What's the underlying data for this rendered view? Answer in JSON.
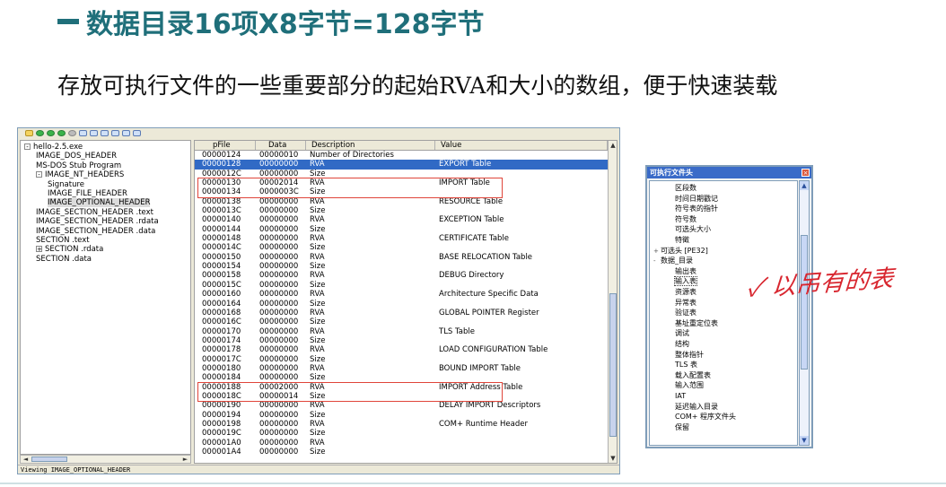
{
  "slide": {
    "title": "数据目录16项X8字节=128字节",
    "subtitle": "存放可执行文件的一些重要部分的起始RVA和大小的数组，便于快速装载"
  },
  "viewer": {
    "status_text": "Viewing IMAGE_OPTIONAL_HEADER",
    "tree": [
      {
        "label": "hello-2.5.exe",
        "level": 0,
        "expander": "-"
      },
      {
        "label": "IMAGE_DOS_HEADER",
        "level": 1,
        "expander": ""
      },
      {
        "label": "MS-DOS Stub Program",
        "level": 1,
        "expander": ""
      },
      {
        "label": "IMAGE_NT_HEADERS",
        "level": 1,
        "expander": "-"
      },
      {
        "label": "Signature",
        "level": 2,
        "expander": ""
      },
      {
        "label": "IMAGE_FILE_HEADER",
        "level": 2,
        "expander": ""
      },
      {
        "label": "IMAGE_OPTIONAL_HEADER",
        "level": 2,
        "expander": "",
        "selected": true
      },
      {
        "label": "IMAGE_SECTION_HEADER .text",
        "level": 1,
        "expander": ""
      },
      {
        "label": "IMAGE_SECTION_HEADER .rdata",
        "level": 1,
        "expander": ""
      },
      {
        "label": "IMAGE_SECTION_HEADER .data",
        "level": 1,
        "expander": ""
      },
      {
        "label": "SECTION .text",
        "level": 1,
        "expander": ""
      },
      {
        "label": "SECTION .rdata",
        "level": 1,
        "expander": "+"
      },
      {
        "label": "SECTION .data",
        "level": 1,
        "expander": ""
      }
    ],
    "columns": [
      "pFile",
      "Data",
      "Description",
      "Value"
    ],
    "rows": [
      [
        "00000124",
        "00000010",
        "Number of Directories",
        ""
      ],
      [
        "00000128",
        "00000000",
        "RVA",
        "EXPORT Table"
      ],
      [
        "0000012C",
        "00000000",
        "Size",
        ""
      ],
      [
        "00000130",
        "00002014",
        "RVA",
        "IMPORT Table"
      ],
      [
        "00000134",
        "0000003C",
        "Size",
        ""
      ],
      [
        "00000138",
        "00000000",
        "RVA",
        "RESOURCE Table"
      ],
      [
        "0000013C",
        "00000000",
        "Size",
        ""
      ],
      [
        "00000140",
        "00000000",
        "RVA",
        "EXCEPTION Table"
      ],
      [
        "00000144",
        "00000000",
        "Size",
        ""
      ],
      [
        "00000148",
        "00000000",
        "RVA",
        "CERTIFICATE Table"
      ],
      [
        "0000014C",
        "00000000",
        "Size",
        ""
      ],
      [
        "00000150",
        "00000000",
        "RVA",
        "BASE RELOCATION Table"
      ],
      [
        "00000154",
        "00000000",
        "Size",
        ""
      ],
      [
        "00000158",
        "00000000",
        "RVA",
        "DEBUG Directory"
      ],
      [
        "0000015C",
        "00000000",
        "Size",
        ""
      ],
      [
        "00000160",
        "00000000",
        "RVA",
        "Architecture Specific Data"
      ],
      [
        "00000164",
        "00000000",
        "Size",
        ""
      ],
      [
        "00000168",
        "00000000",
        "RVA",
        "GLOBAL POINTER Register"
      ],
      [
        "0000016C",
        "00000000",
        "Size",
        ""
      ],
      [
        "00000170",
        "00000000",
        "RVA",
        "TLS Table"
      ],
      [
        "00000174",
        "00000000",
        "Size",
        ""
      ],
      [
        "00000178",
        "00000000",
        "RVA",
        "LOAD CONFIGURATION Table"
      ],
      [
        "0000017C",
        "00000000",
        "Size",
        ""
      ],
      [
        "00000180",
        "00000000",
        "RVA",
        "BOUND IMPORT Table"
      ],
      [
        "00000184",
        "00000000",
        "Size",
        ""
      ],
      [
        "00000188",
        "00002000",
        "RVA",
        "IMPORT Address Table"
      ],
      [
        "0000018C",
        "00000014",
        "Size",
        ""
      ],
      [
        "00000190",
        "00000000",
        "RVA",
        "DELAY IMPORT Descriptors"
      ],
      [
        "00000194",
        "00000000",
        "Size",
        ""
      ],
      [
        "00000198",
        "00000000",
        "RVA",
        "COM+ Runtime Header"
      ],
      [
        "0000019C",
        "00000000",
        "Size",
        ""
      ],
      [
        "000001A0",
        "00000000",
        "RVA",
        ""
      ],
      [
        "000001A4",
        "00000000",
        "Size",
        ""
      ]
    ],
    "selected_row": 1,
    "highlighted_rows": [
      [
        3,
        4
      ],
      [
        25,
        26
      ]
    ],
    "highlight_color": "#e0453a",
    "selection_color": "#316ac5"
  },
  "panel": {
    "title": "可执行文件头",
    "close_glyph": "×",
    "items": [
      {
        "label": "区段数",
        "level": 2,
        "expander": ""
      },
      {
        "label": "时间日期戳记",
        "level": 2,
        "expander": ""
      },
      {
        "label": "符号表的指针",
        "level": 2,
        "expander": ""
      },
      {
        "label": "符号数",
        "level": 2,
        "expander": ""
      },
      {
        "label": "可选头大小",
        "level": 2,
        "expander": ""
      },
      {
        "label": "特徵",
        "level": 2,
        "expander": ""
      },
      {
        "label": "可选头 [PE32]",
        "level": 0,
        "expander": "+"
      },
      {
        "label": "数据_目录",
        "level": 0,
        "expander": "-"
      },
      {
        "label": "输出表",
        "level": 2,
        "expander": ""
      },
      {
        "label": "输入表",
        "level": 2,
        "expander": "",
        "selected": true
      },
      {
        "label": "资源表",
        "level": 2,
        "expander": ""
      },
      {
        "label": "异常表",
        "level": 2,
        "expander": ""
      },
      {
        "label": "验证表",
        "level": 2,
        "expander": ""
      },
      {
        "label": "基址重定位表",
        "level": 2,
        "expander": ""
      },
      {
        "label": "调试",
        "level": 2,
        "expander": ""
      },
      {
        "label": "结构",
        "level": 2,
        "expander": ""
      },
      {
        "label": "整体指针",
        "level": 2,
        "expander": ""
      },
      {
        "label": "TLS 表",
        "level": 2,
        "expander": ""
      },
      {
        "label": "载入配置表",
        "level": 2,
        "expander": ""
      },
      {
        "label": "输入范围",
        "level": 2,
        "expander": ""
      },
      {
        "label": "IAT",
        "level": 2,
        "expander": ""
      },
      {
        "label": "延迟输入目录",
        "level": 2,
        "expander": ""
      },
      {
        "label": "COM+ 程序文件头",
        "level": 2,
        "expander": ""
      },
      {
        "label": "保留",
        "level": 2,
        "expander": ""
      }
    ]
  },
  "annotation": {
    "handwritten_text": "✓ 以吊有的表",
    "color": "#d8262f"
  },
  "colors": {
    "title": "#1f6f7a"
  }
}
